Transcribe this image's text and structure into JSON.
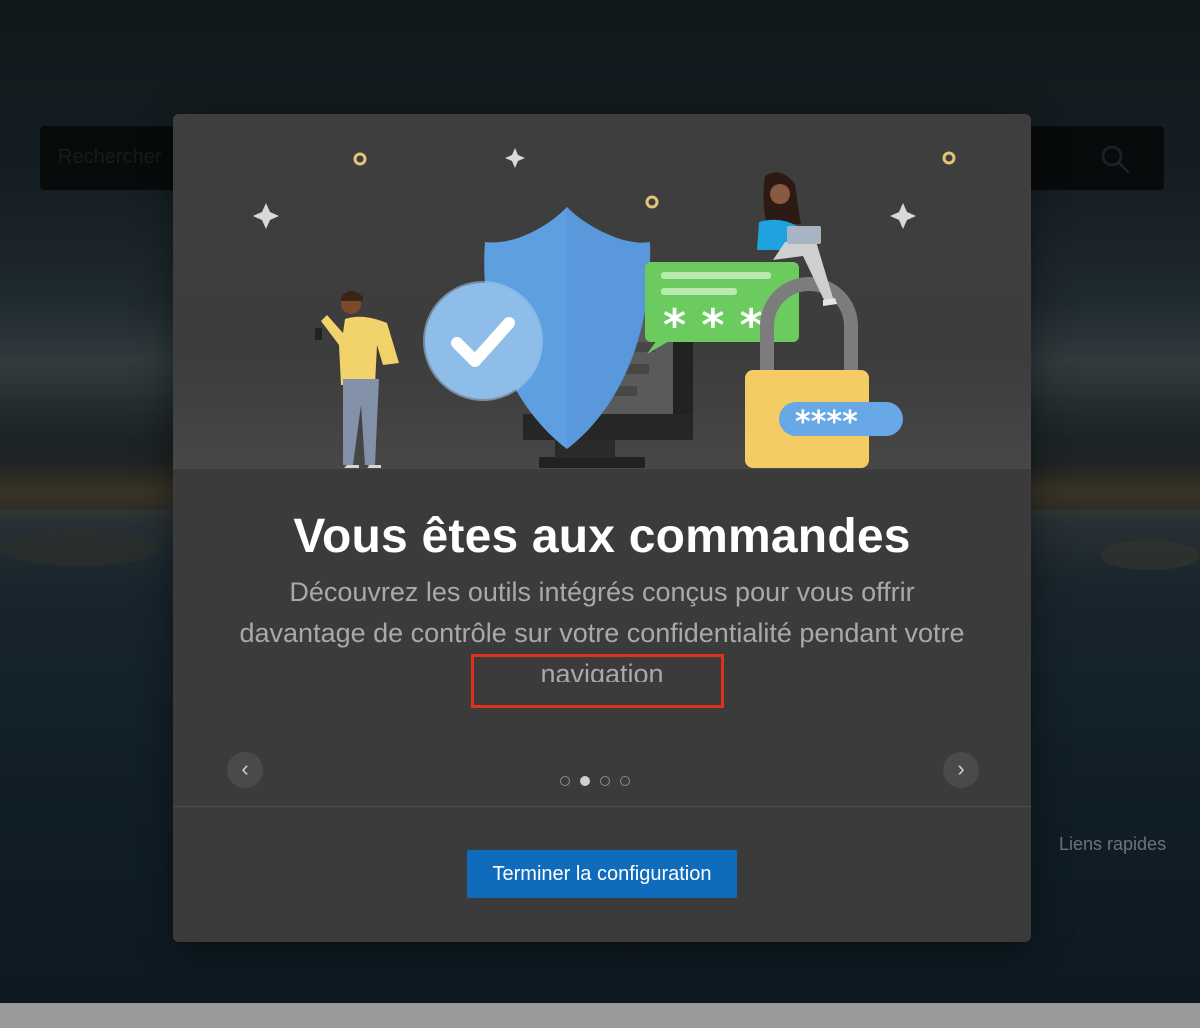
{
  "background": {
    "search_placeholder": "Rechercher",
    "quick_links": "Liens rapides"
  },
  "modal": {
    "title": "Vous êtes aux commandes",
    "subtitle": "Découvrez les outils intégrés conçus pour vous offrir davantage de contrôle sur votre confidentialité pendant votre navigation",
    "prev_label": "‹",
    "next_label": "›",
    "dots": {
      "count": 4,
      "active_index": 1
    },
    "cta_label": "Terminer la configuration",
    "password_mask_bubble": "* * *",
    "password_mask_pill": "****"
  },
  "colors": {
    "accent": "#0f6cbd",
    "highlight": "#e0311c"
  }
}
